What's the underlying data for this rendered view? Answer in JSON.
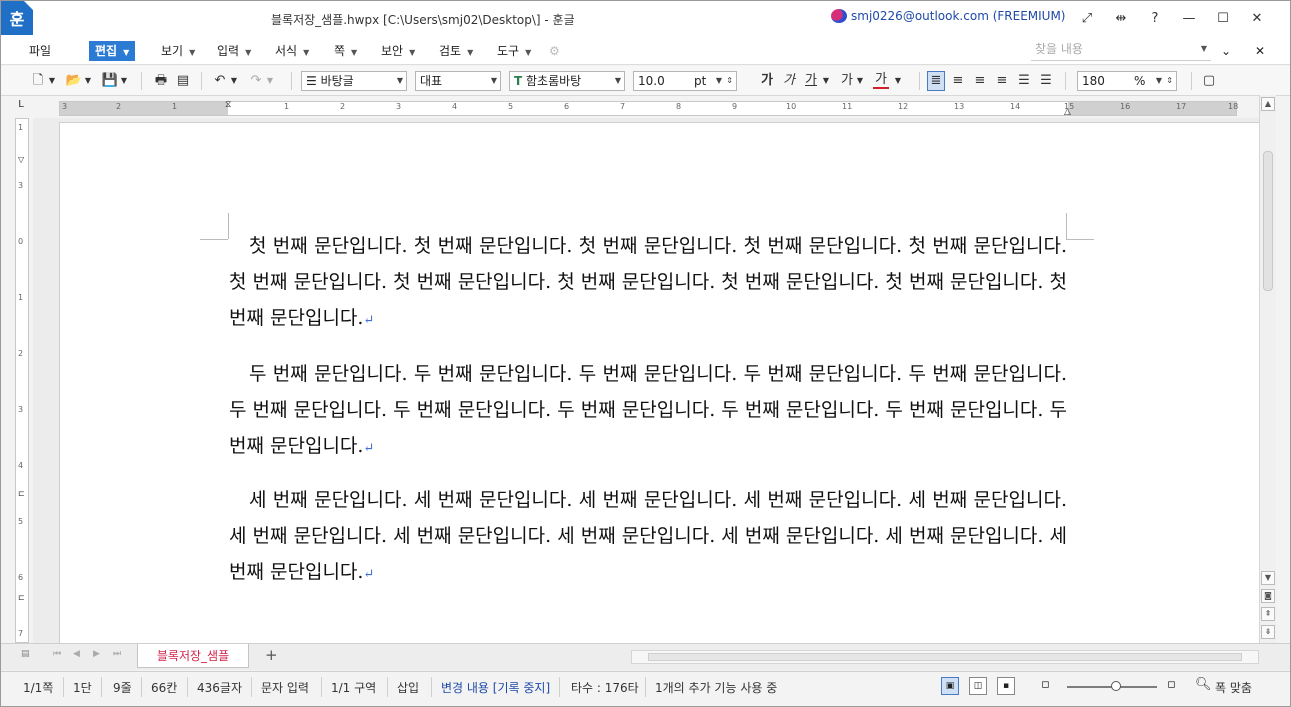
{
  "window": {
    "app_icon": "훈",
    "title": "블록저장_샘플.hwpx [C:\\Users\\smj02\\Desktop\\] - 훈글",
    "account": "smj0226@outlook.com (FREEMIUM)",
    "controls": [
      "⤢",
      "⇹",
      "?",
      "—",
      "☐",
      "✕"
    ]
  },
  "menu": {
    "items": [
      "파일",
      "편집",
      "보기",
      "입력",
      "서식",
      "쪽",
      "보안",
      "검토",
      "도구"
    ],
    "active": "편집",
    "find_placeholder": "찾을 내용"
  },
  "toolbar": {
    "style": "바탕글",
    "font_group": "대표",
    "font": "함초롬바탕",
    "size": "10.0",
    "size_unit": "pt",
    "format_buttons": [
      "가",
      "가",
      "가",
      "가",
      "가"
    ],
    "zoom": "180",
    "zoom_unit": "%"
  },
  "ruler": {
    "h_labels": [
      "3",
      "2",
      "1",
      "1",
      "2",
      "3",
      "4",
      "5",
      "6",
      "7",
      "8",
      "9",
      "10",
      "11",
      "12",
      "13",
      "14",
      "15",
      "16",
      "17",
      "18"
    ],
    "v_labels": [
      "1",
      "2",
      "3",
      "0",
      "1",
      "2",
      "3",
      "4",
      "5",
      "6",
      "7"
    ],
    "corner": "L"
  },
  "document": {
    "paragraphs": [
      "첫 번째 문단입니다. 첫 번째 문단입니다. 첫 번째 문단입니다. 첫 번째 문단입니다. 첫 번째 문단입니다. 첫 번째 문단입니다. 첫 번째 문단입니다. 첫 번째 문단입니다. 첫 번째 문단입니다. 첫 번째 문단입니다. 첫 번째 문단입니다.",
      "두 번째 문단입니다. 두 번째 문단입니다. 두 번째 문단입니다. 두 번째 문단입니다. 두 번째 문단입니다. 두 번째 문단입니다. 두 번째 문단입니다. 두 번째 문단입니다. 두 번째 문단입니다. 두 번째 문단입니다. 두 번째 문단입니다.",
      "세 번째 문단입니다. 세 번째 문단입니다. 세 번째 문단입니다. 세 번째 문단입니다. 세 번째 문단입니다. 세 번째 문단입니다. 세 번째 문단입니다. 세 번째 문단입니다. 세 번째 문단입니다. 세 번째 문단입니다. 세 번째 문단입니다."
    ],
    "para_mark": "↵"
  },
  "tabs": {
    "active_tab": "블록저장_샘플",
    "add": "+"
  },
  "status": {
    "page": "1/1쪽",
    "column": "1단",
    "line": "9줄",
    "pos": "66칸",
    "chars": "436글자",
    "input_mode": "문자 입력",
    "section": "1/1 구역",
    "insert": "삽입",
    "track": "변경 내용 [기록 중지]",
    "typing": "타수 : 176타",
    "addon": "1개의 추가 기능 사용 중",
    "fit": "폭 맞춤"
  }
}
